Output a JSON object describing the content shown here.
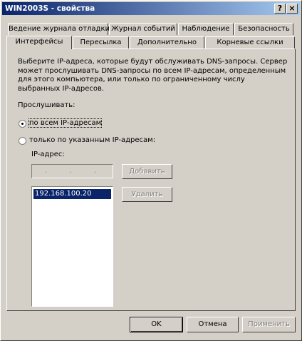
{
  "window": {
    "title": "WIN2003S - свойства",
    "help_glyph": "?",
    "close_glyph": "×"
  },
  "tabs_row1": [
    {
      "label": "Ведение журнала отладки"
    },
    {
      "label": "Журнал событий"
    },
    {
      "label": "Наблюдение"
    },
    {
      "label": "Безопасность"
    }
  ],
  "tabs_row2": [
    {
      "label": "Интерфейсы",
      "active": true
    },
    {
      "label": "Пересылка"
    },
    {
      "label": "Дополнительно"
    },
    {
      "label": "Корневые ссылки"
    }
  ],
  "content": {
    "description": "Выберите IP-адреса, которые будут обслуживать DNS-запросы. Сервер может прослушивать DNS-запросы по всем IP-адресам, определенным для этого компьютера, или только по ограниченному числу выбранных IP-адресов.",
    "listen_label": "Прослушивать:",
    "radio_all_label": "по всем IP-адресам",
    "radio_specified_label": "только по указанным IP-адресам:",
    "ip_label": "IP-адрес:",
    "ip_placeholder": ". . .",
    "add_button": "Добавить",
    "remove_button": "Удалить",
    "ip_list": [
      "192.168.100.20"
    ]
  },
  "buttons": {
    "ok": "OK",
    "cancel": "Отмена",
    "apply": "Применить"
  }
}
